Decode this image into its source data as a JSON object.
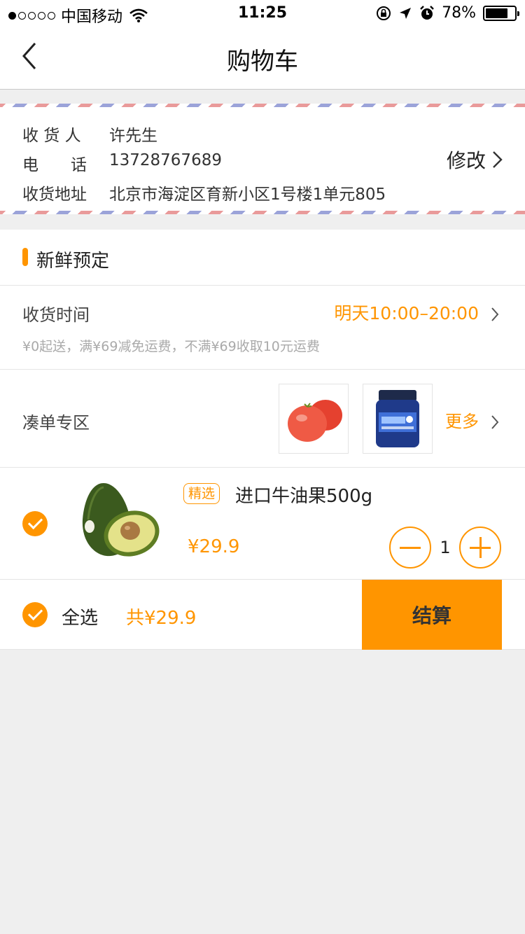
{
  "status_bar": {
    "carrier": "中国移动",
    "time": "11:25",
    "battery": "78%",
    "battery_level": 0.78,
    "icons": [
      "signal-dots-icon",
      "wifi-icon",
      "orientation-lock-icon",
      "location-icon",
      "alarm-icon",
      "battery-icon"
    ]
  },
  "nav": {
    "title": "购物车",
    "back_icon": "chevron-left-icon"
  },
  "address": {
    "recipient_label": "收 货 人",
    "recipient": "许先生",
    "phone_label": "电　　话",
    "phone": "13728767689",
    "address_label": "收货地址",
    "address": "北京市海淀区育新小区1号楼1单元805",
    "edit_label": "修改"
  },
  "section": {
    "title": "新鲜预定"
  },
  "delivery": {
    "label": "收货时间",
    "time": "明天10:00–20:00",
    "note": "¥0起送，满¥69减免运费，不满¥69收取10元运费"
  },
  "addon": {
    "label": "凑单专区",
    "more_label": "更多",
    "products": [
      "tomato",
      "blueberry-jam"
    ]
  },
  "cart_item": {
    "tag": "精选",
    "name": "进口牛油果500g",
    "price": "¥29.9",
    "quantity": "1",
    "checked": true
  },
  "footer": {
    "select_all_label": "全选",
    "total": "共¥29.9",
    "checkout_label": "结算"
  },
  "colors": {
    "accent": "#ff9500",
    "background": "#efefef"
  }
}
